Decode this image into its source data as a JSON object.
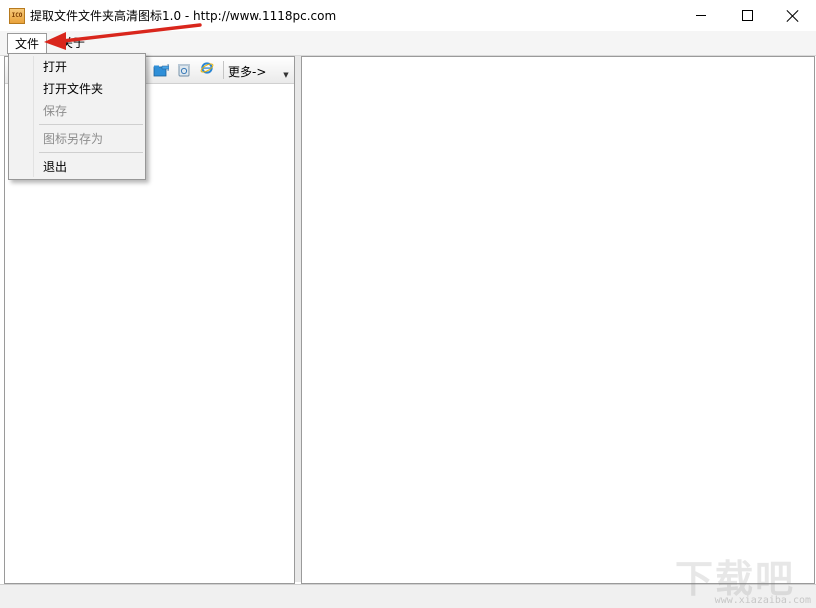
{
  "window": {
    "title": "提取文件文件夹高清图标1.0 - http://www.1118pc.com",
    "app_icon_text": "ICO",
    "controls": [
      "minimize-icon",
      "maximize-icon",
      "close-icon"
    ]
  },
  "menubar": {
    "file": "文件",
    "about": "关于"
  },
  "file_menu": {
    "items": [
      {
        "label": "打开",
        "enabled": true
      },
      {
        "label": "打开文件夹",
        "enabled": true
      },
      {
        "label": "保存",
        "enabled": false
      },
      {
        "label": "图标另存为",
        "enabled": false
      },
      {
        "label": "退出",
        "enabled": true
      }
    ]
  },
  "toolbar": {
    "icons": [
      "folder-share-icon",
      "recycle-bin-icon",
      "ie-browser-icon"
    ],
    "more_label": "更多->",
    "overflow_icon": "overflow-chevron-icon"
  },
  "annotation": {
    "arrow_color": "#d9261c"
  },
  "watermark": {
    "text": "下载吧",
    "url": "www.xiazaiba.com"
  }
}
